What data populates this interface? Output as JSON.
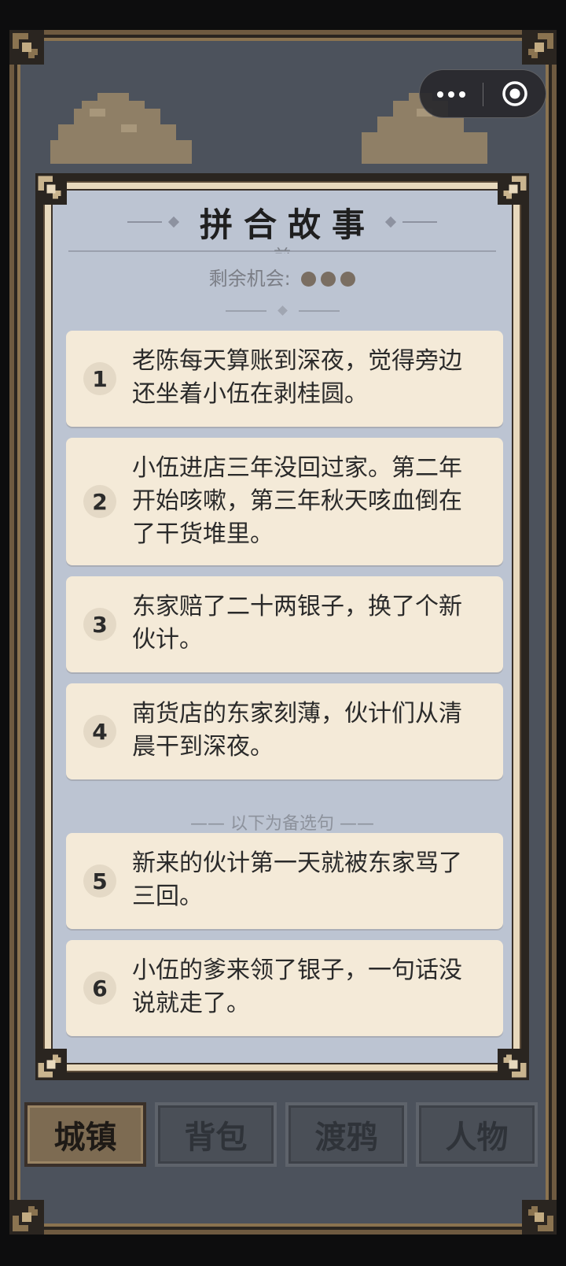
{
  "title": "拼合故事",
  "clipped_text": "前",
  "chances_label": "剩余机会:",
  "chances_remaining": 3,
  "sentences": [
    {
      "num": "1",
      "text": "老陈每天算账到深夜，觉得旁边还坐着小伍在剥桂圆。"
    },
    {
      "num": "2",
      "text": "小伍进店三年没回过家。第二年开始咳嗽，第三年秋天咳血倒在了干货堆里。"
    },
    {
      "num": "3",
      "text": "东家赔了二十两银子，换了个新伙计。"
    },
    {
      "num": "4",
      "text": "南货店的东家刻薄，伙计们从清晨干到深夜。"
    }
  ],
  "alternates_label": "—— 以下为备选句 ——",
  "alternates": [
    {
      "num": "5",
      "text": "新来的伙计第一天就被东家骂了三回。"
    },
    {
      "num": "6",
      "text": "小伍的爹来领了银子，一句话没说就走了。"
    }
  ],
  "tabs": [
    {
      "label": "城镇",
      "active": true
    },
    {
      "label": "背包",
      "active": false
    },
    {
      "label": "渡鸦",
      "active": false
    },
    {
      "label": "人物",
      "active": false
    }
  ],
  "colors": {
    "card_bg": "#f4ead8",
    "modal_bg": "#bcc4d2",
    "frame_gold": "#8a7350"
  },
  "icons": {
    "menu": "more-dots-icon",
    "close": "target-circle-icon"
  }
}
